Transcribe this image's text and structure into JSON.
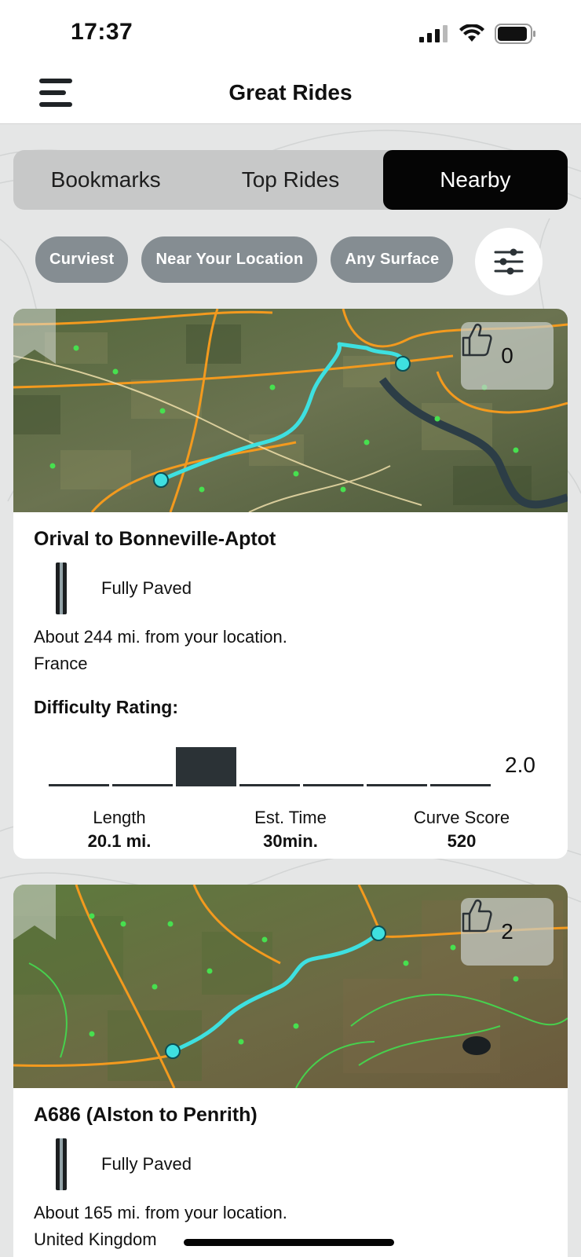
{
  "status_bar": {
    "time": "17:37"
  },
  "header": {
    "title": "Great Rides",
    "menu_icon": "hamburger-menu-icon"
  },
  "tabs": [
    {
      "label": "Bookmarks",
      "active": false
    },
    {
      "label": "Top Rides",
      "active": false
    },
    {
      "label": "Nearby",
      "active": true
    }
  ],
  "filters": {
    "chips": [
      "Curviest",
      "Near Your Location",
      "Any Surface"
    ],
    "settings_icon": "sliders-icon"
  },
  "rides": [
    {
      "title": "Orival to Bonneville-Aptot",
      "likes": "0",
      "surface": "Fully Paved",
      "distance": "About 244 mi. from your location.",
      "country": "France",
      "difficulty_label": "Difficulty Rating:",
      "difficulty": "2.0",
      "difficulty_level": 3,
      "difficulty_max": 7,
      "stats": [
        {
          "label": "Length",
          "value": "20.1 mi."
        },
        {
          "label": "Est. Time",
          "value": "30min."
        },
        {
          "label": "Curve Score",
          "value": "520"
        }
      ]
    },
    {
      "title": "A686 (Alston to Penrith)",
      "likes": "2",
      "surface": "Fully Paved",
      "distance": "About 165 mi. from your location.",
      "country": "United Kingdom"
    }
  ],
  "colors": {
    "active_tab": "#050505",
    "chip": "#858d92",
    "route": "#3ee0e0",
    "map_road": "#f39a1e"
  }
}
